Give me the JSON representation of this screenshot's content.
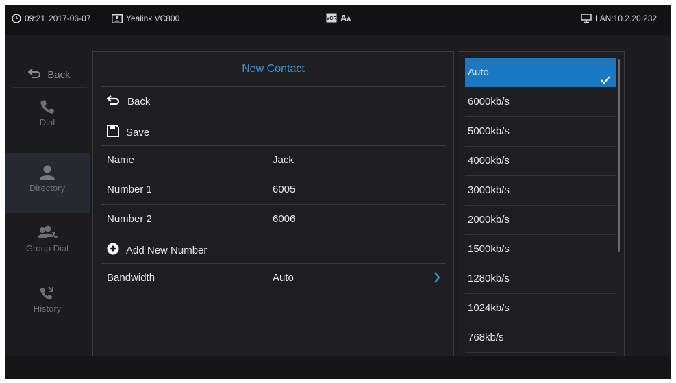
{
  "status_bar": {
    "time": "09:21",
    "date": "2017-06-07",
    "device_name": "Yealink VC800",
    "network": "LAN:10.2.20.232"
  },
  "nav": {
    "back_label": "Back",
    "items": [
      {
        "label": "Dial",
        "icon": "phone-icon",
        "active": false
      },
      {
        "label": "Directory",
        "icon": "person-icon",
        "active": true
      },
      {
        "label": "Group Dial",
        "icon": "group-icon",
        "active": false
      },
      {
        "label": "History",
        "icon": "call-history-icon",
        "active": false
      }
    ]
  },
  "contact_form": {
    "title": "New Contact",
    "back_label": "Back",
    "save_label": "Save",
    "fields": [
      {
        "label": "Name",
        "value": "Jack"
      },
      {
        "label": "Number 1",
        "value": "6005"
      },
      {
        "label": "Number 2",
        "value": "6006"
      }
    ],
    "add_number_label": "Add New Number",
    "bandwidth": {
      "label": "Bandwidth",
      "value": "Auto"
    }
  },
  "bandwidth_options": {
    "selected": "Auto",
    "items": [
      "Auto",
      "6000kb/s",
      "5000kb/s",
      "4000kb/s",
      "3000kb/s",
      "2000kb/s",
      "1500kb/s",
      "1280kb/s",
      "1024kb/s",
      "768kb/s"
    ]
  },
  "colors": {
    "accent": "#2f9be5",
    "selected_bg": "#1a78c2",
    "background": "#1c1c1e"
  }
}
